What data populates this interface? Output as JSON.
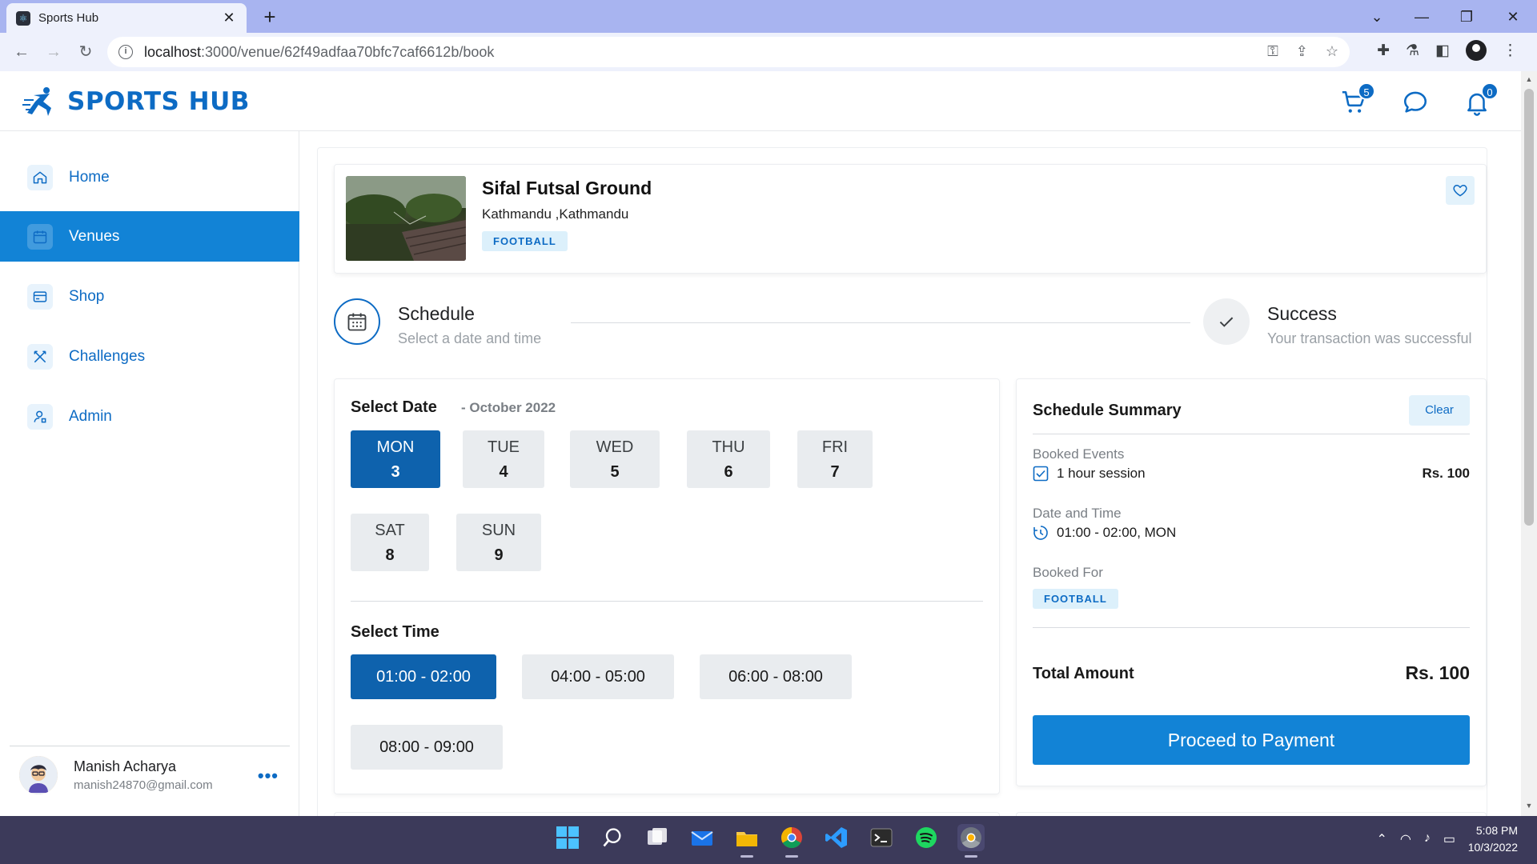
{
  "browser": {
    "tab_title": "Sports Hub",
    "url_host": "localhost",
    "url_path": ":3000/venue/62f49adfaa70bfc7caf6612b/book"
  },
  "header": {
    "brand": "SPORTS HUB",
    "cart_count": "5",
    "notification_count": "0"
  },
  "sidebar": {
    "items": [
      {
        "label": "Home",
        "icon": "home-icon"
      },
      {
        "label": "Venues",
        "icon": "calendar-icon",
        "active": true
      },
      {
        "label": "Shop",
        "icon": "card-icon"
      },
      {
        "label": "Challenges",
        "icon": "swords-icon"
      },
      {
        "label": "Admin",
        "icon": "admin-icon"
      }
    ],
    "user": {
      "name": "Manish Acharya",
      "email": "manish24870@gmail.com"
    }
  },
  "venue": {
    "name": "Sifal Futsal Ground",
    "location": "Kathmandu ,Kathmandu",
    "sport": "FOOTBALL"
  },
  "stepper": {
    "step1_title": "Schedule",
    "step1_sub": "Select a date and time",
    "step2_title": "Success",
    "step2_sub": "Your transaction was successful"
  },
  "date_picker": {
    "title": "Select Date",
    "month": "- October 2022",
    "days": [
      {
        "name": "MON",
        "date": "3",
        "selected": true
      },
      {
        "name": "TUE",
        "date": "4"
      },
      {
        "name": "WED",
        "date": "5"
      },
      {
        "name": "THU",
        "date": "6"
      },
      {
        "name": "FRI",
        "date": "7"
      },
      {
        "name": "SAT",
        "date": "8"
      },
      {
        "name": "SUN",
        "date": "9"
      }
    ]
  },
  "time_picker": {
    "title": "Select Time",
    "slots": [
      {
        "label": "01:00 - 02:00",
        "selected": true
      },
      {
        "label": "04:00 - 05:00"
      },
      {
        "label": "06:00 - 08:00"
      },
      {
        "label": "08:00 - 09:00"
      }
    ]
  },
  "summary": {
    "title": "Schedule Summary",
    "clear_label": "Clear",
    "booked_events_label": "Booked Events",
    "event_name": "1 hour session",
    "event_price": "Rs. 100",
    "date_time_label": "Date and Time",
    "date_time_value": "01:00 - 02:00, MON",
    "booked_for_label": "Booked For",
    "booked_for_value": "FOOTBALL",
    "total_label": "Total Amount",
    "total_value": "Rs. 100",
    "pay_label": "Proceed to Payment"
  },
  "taskbar": {
    "time": "5:08 PM",
    "date": "10/3/2022"
  },
  "colors": {
    "brand": "#0d6bc4",
    "active_nav": "#1283d6",
    "selected": "#0e62ad"
  }
}
